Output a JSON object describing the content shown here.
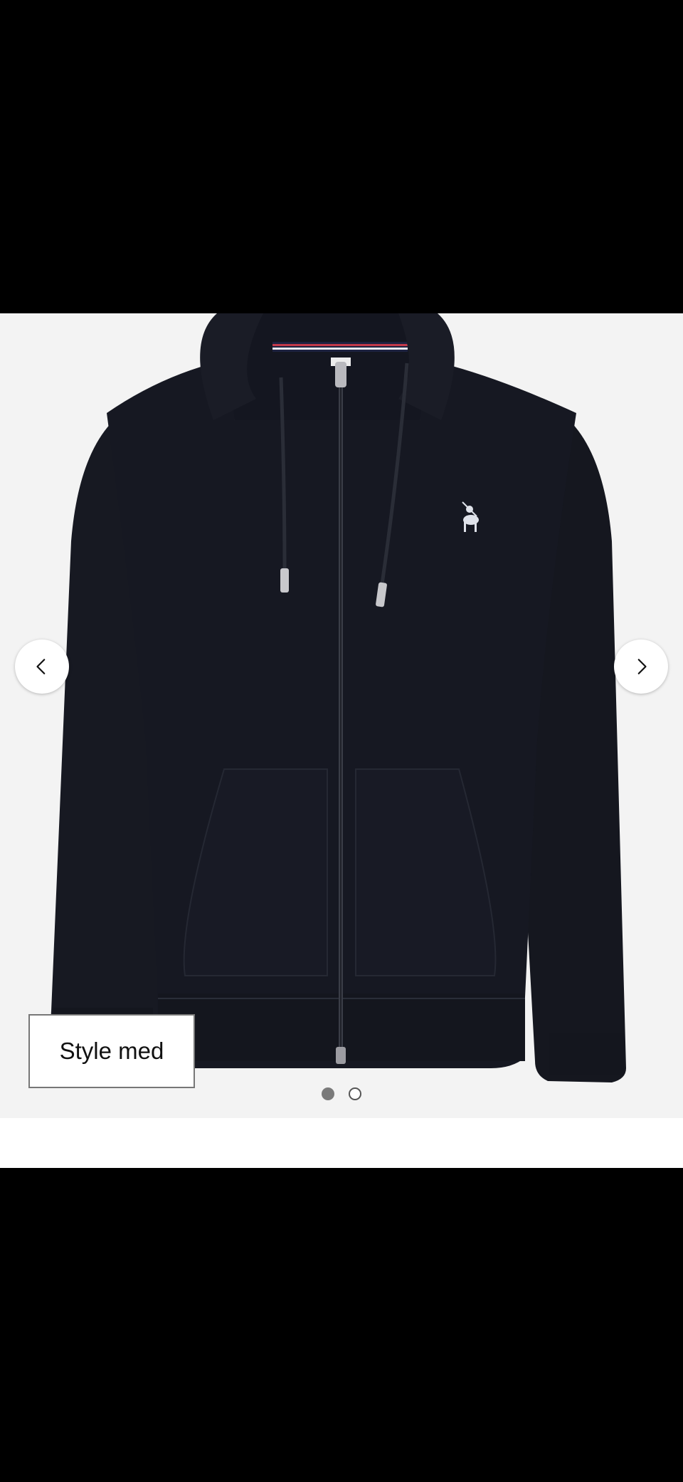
{
  "gallery": {
    "style_with_label": "Style med",
    "slide_count": 2,
    "active_slide": 1,
    "prev_icon": "chevron-left-icon",
    "next_icon": "chevron-right-icon",
    "background_color": "#f3f3f3",
    "product_color": "#16181f"
  }
}
